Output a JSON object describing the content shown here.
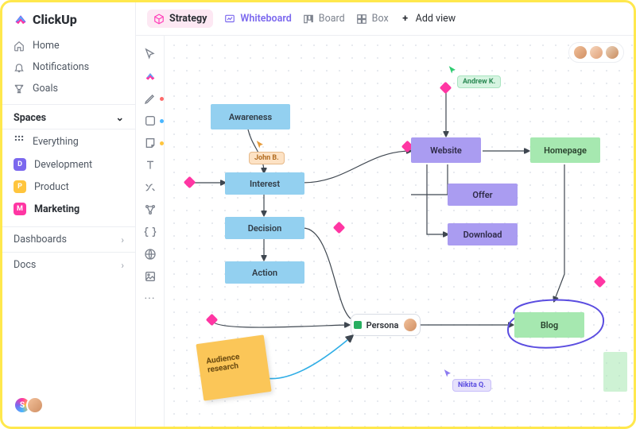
{
  "brand": {
    "name": "ClickUp"
  },
  "nav": {
    "home": "Home",
    "notifications": "Notifications",
    "goals": "Goals"
  },
  "spaces": {
    "header": "Spaces",
    "everything": "Everything",
    "items": [
      {
        "label": "Development",
        "badge": "D",
        "color": "#7b68ee"
      },
      {
        "label": "Product",
        "badge": "P",
        "color": "#ffc53d"
      },
      {
        "label": "Marketing",
        "badge": "M",
        "color": "#ff36a3"
      }
    ]
  },
  "rows": {
    "dashboards": "Dashboards",
    "docs": "Docs"
  },
  "views": {
    "strategy": "Strategy",
    "whiteboard": "Whiteboard",
    "board": "Board",
    "box": "Box",
    "add": "Add view"
  },
  "nodes": {
    "awareness": "Awareness",
    "interest": "Interest",
    "decision": "Decision",
    "action": "Action",
    "website": "Website",
    "offer": "Offer",
    "download": "Download",
    "homepage": "Homepage",
    "blog": "Blog",
    "persona": "Persona"
  },
  "sticky": {
    "audience": "Audience\nresearch"
  },
  "users": {
    "john": "John B.",
    "andrew": "Andrew K.",
    "nikita": "Nikita Q."
  },
  "colors": {
    "accent_purple": "#7b68ee",
    "accent_pink": "#ff36a3",
    "handle_pink": "#ff36a3",
    "node_blue": "#93d0f0",
    "node_purple": "#aa9cf1",
    "node_green": "#a6e8b0",
    "sticky_yellow": "#fbc658"
  }
}
